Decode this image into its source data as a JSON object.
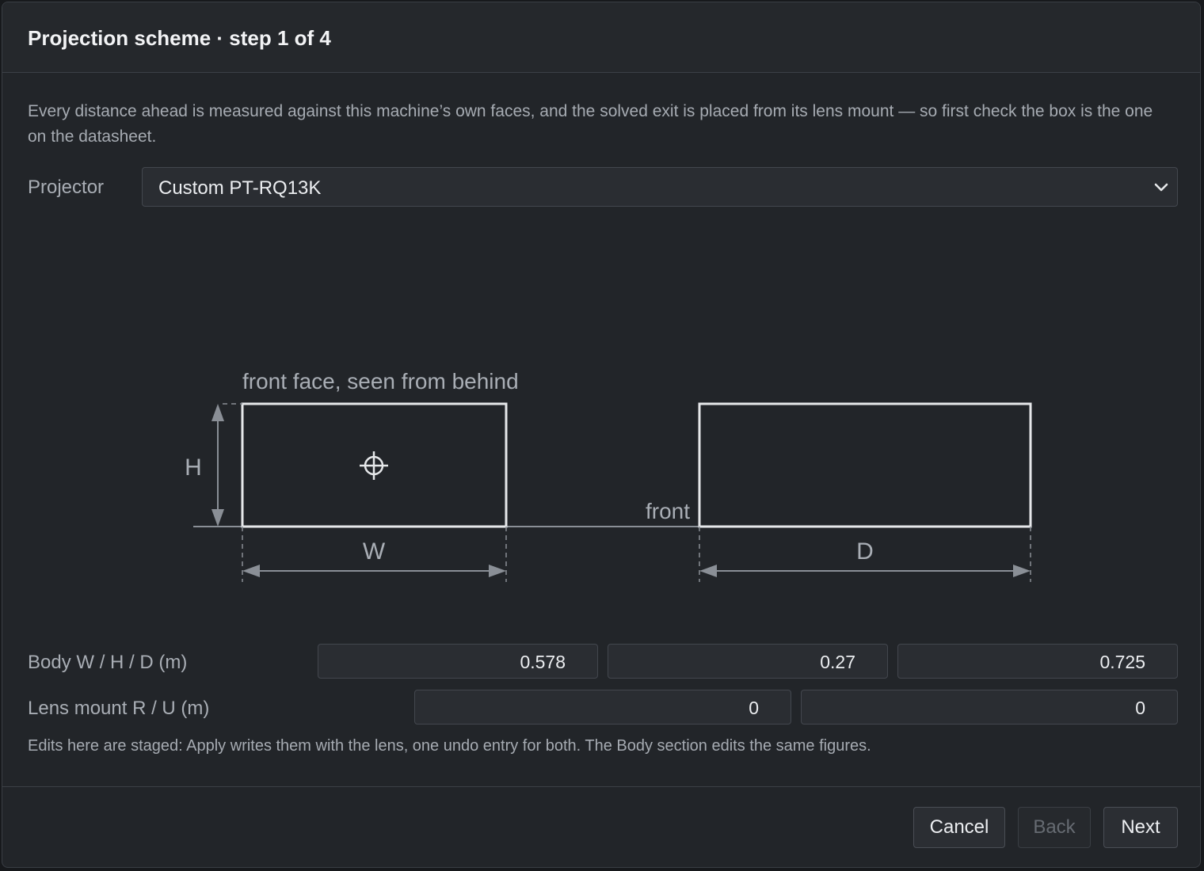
{
  "dialog": {
    "title": "Projection scheme · step 1 of 4",
    "intro": "Every distance ahead is measured against this machine’s own faces, and the solved exit is placed from its lens mount — so first check the box is the one on the datasheet."
  },
  "projector": {
    "label": "Projector",
    "selected": "Custom PT-RQ13K"
  },
  "diagram": {
    "front_face_caption": "front face, seen from behind",
    "h_label": "H",
    "w_label": "W",
    "d_label": "D",
    "front_label": "front",
    "lens_mount_icon": "crosshair-icon"
  },
  "body": {
    "label": "Body W / H / D (m)",
    "w": "0.578",
    "h": "0.27",
    "d": "0.725"
  },
  "lens_mount": {
    "label": "Lens mount R / U (m)",
    "r": "0",
    "u": "0"
  },
  "note": "Edits here are staged: Apply writes them with the lens, one undo entry for both. The Body section edits the same figures.",
  "buttons": {
    "cancel": "Cancel",
    "back": "Back",
    "next": "Next"
  },
  "colors": {
    "background": "#222529",
    "text": "#eceef1",
    "muted": "#a6abb2",
    "diagram_line": "#e6e8ea",
    "dimension_line": "#8a8f96"
  }
}
